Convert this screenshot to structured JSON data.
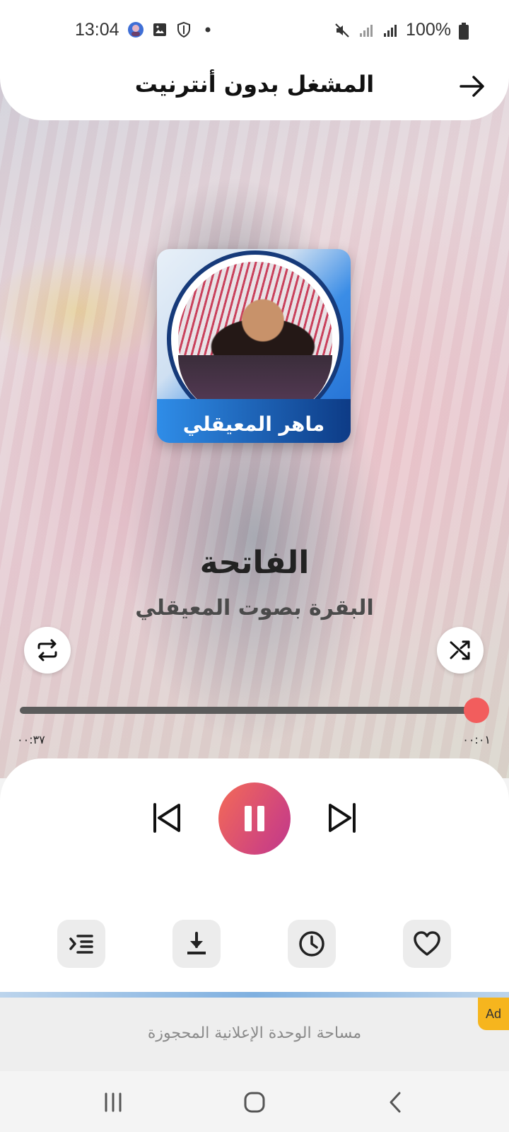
{
  "status_bar": {
    "time": "13:04",
    "battery": "100%"
  },
  "header": {
    "title": "المشغل بدون أنترنيت"
  },
  "cover": {
    "name": "ماهر المعيقلي"
  },
  "track": {
    "title": "الفاتحة",
    "subtitle": "البقرة بصوت المعيقلي"
  },
  "progress": {
    "position_fraction": 1.0,
    "time_left": "٠٠:٣٧",
    "time_right": "٠٠:٠١"
  },
  "ad": {
    "text": "مساحة الوحدة الإعلانية المحجوزة",
    "badge": "Ad"
  },
  "colors": {
    "accent": "#f25d5d",
    "play_gradient_start": "#f46b56",
    "play_gradient_end": "#c0398a",
    "ad_badge": "#f6b51e"
  }
}
